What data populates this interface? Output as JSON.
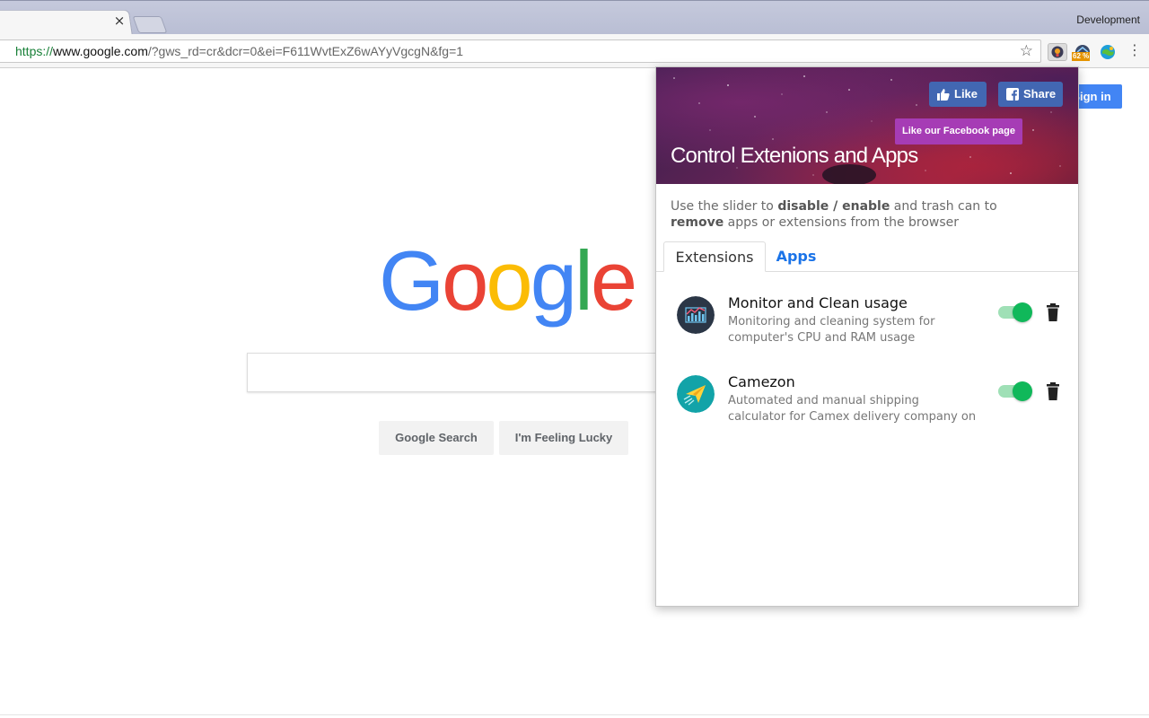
{
  "browser": {
    "profile_label": "Development",
    "tab_close_glyph": "×",
    "url_scheme": "https://",
    "url_host": "www.google.com",
    "url_rest": "/?gws_rd=cr&dcr=0&ei=F611WvtExZ6wAYyVgcgN&fg=1",
    "star_glyph": "☆",
    "extension_badge": "62 %",
    "menu_glyph": "⋮"
  },
  "google": {
    "signin_label": "Sign in",
    "logo_letters": [
      "G",
      "o",
      "o",
      "g",
      "l",
      "e"
    ],
    "logo_colors": [
      "#4285f4",
      "#ea4335",
      "#fbbc05",
      "#4285f4",
      "#34a853",
      "#ea4335"
    ],
    "search_button": "Google Search",
    "lucky_button": "I'm Feeling Lucky"
  },
  "popup": {
    "like_label": "Like",
    "share_label": "Share",
    "fb_page_label": "Like our Facebook page",
    "title": "Control Extenions and Apps",
    "desc_1": "Use the slider to ",
    "desc_bold_1": "disable / enable",
    "desc_2": " and trash can to ",
    "desc_bold_2": "remove",
    "desc_3": " apps or extensions from the browser",
    "tabs": [
      {
        "label": "Extensions",
        "active": true
      },
      {
        "label": "Apps",
        "active": false
      }
    ],
    "items": [
      {
        "name": "Monitor and Clean usage",
        "description": "Monitoring and cleaning system for computer's CPU and RAM usage",
        "enabled": true,
        "icon": "chart-monitor-icon"
      },
      {
        "name": "Camezon",
        "description": "Automated and manual shipping calculator for Camex delivery company on",
        "enabled": true,
        "icon": "paper-plane-icon"
      }
    ]
  },
  "colors": {
    "toggle_on": "#10b85a",
    "fb_blue": "#4267b2",
    "fb_page_purple": "#a63cb5",
    "link_blue": "#1a73e8",
    "google_blue": "#4285f4"
  }
}
